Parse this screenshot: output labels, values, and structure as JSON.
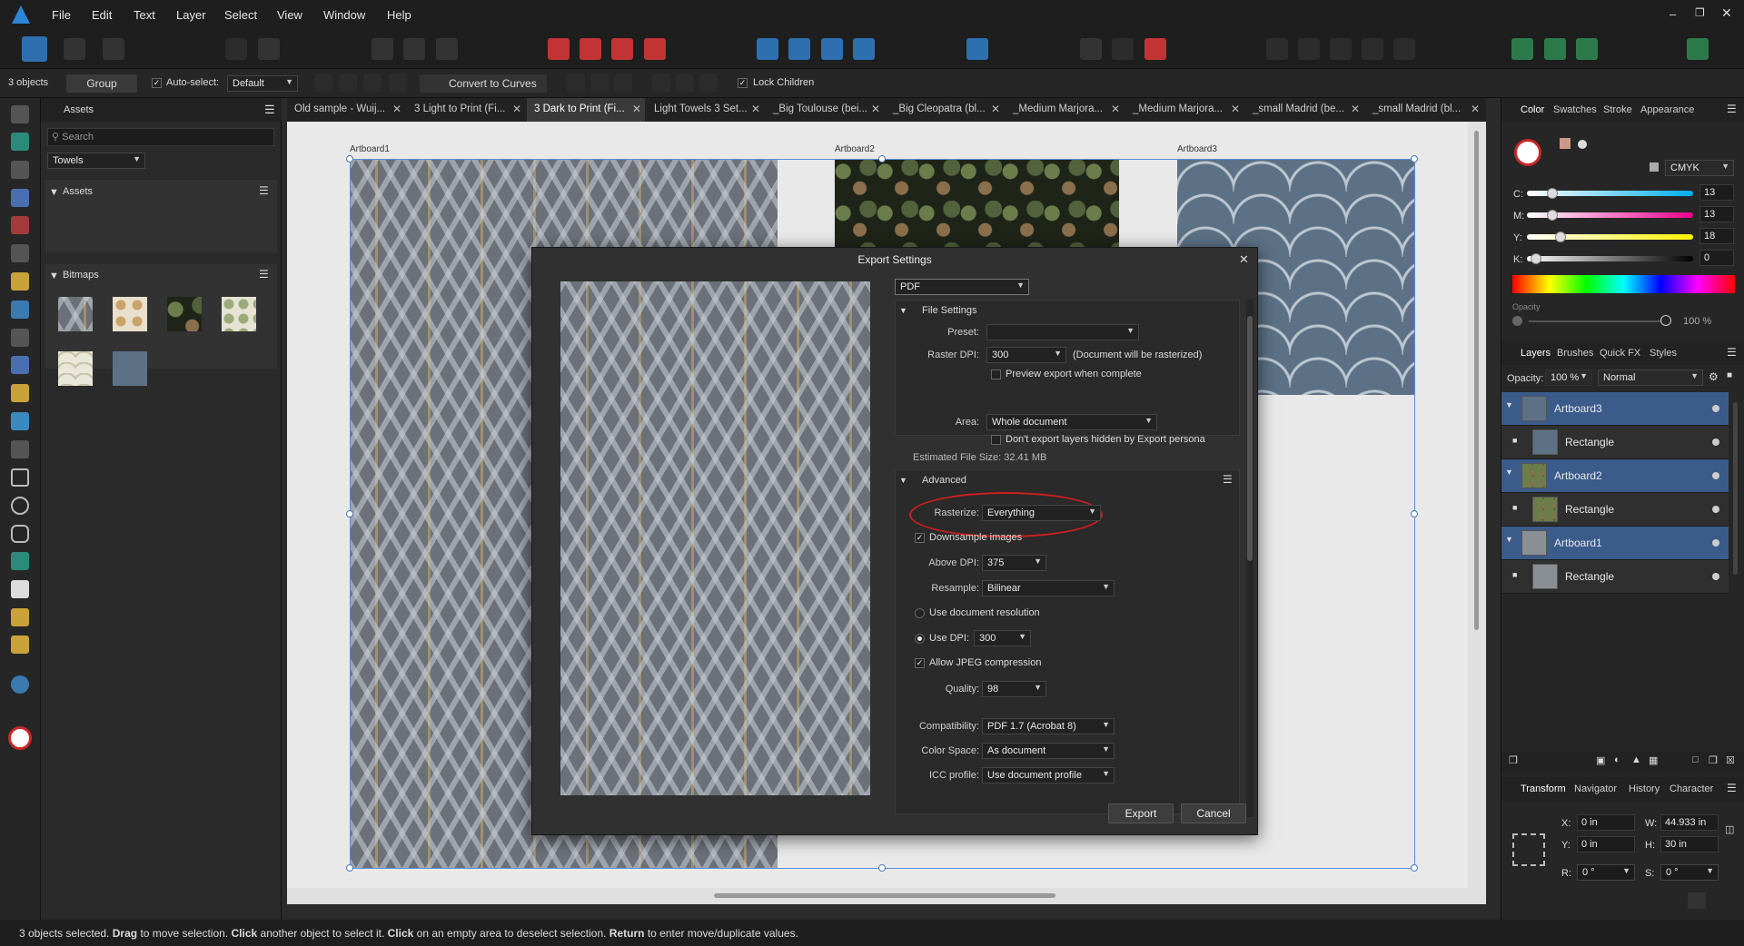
{
  "menu": [
    "File",
    "Edit",
    "Text",
    "Layer",
    "Select",
    "View",
    "Window",
    "Help"
  ],
  "context": {
    "selection_count": "3 objects",
    "group_label": "Group",
    "auto_select_label": "Auto-select:",
    "auto_select_value": "Default",
    "convert_label": "Convert to Curves",
    "lock_children_label": "Lock Children"
  },
  "tabs": [
    "Old sample - Wuij...",
    "3 Light to Print (Fi...",
    "3 Dark to Print (Fi...",
    "Light Towels 3 Set...",
    "_Big Toulouse (bei...",
    "_Big Cleopatra (bl...",
    "_Medium Marjora...",
    "_Medium Marjora...",
    "_small Madrid (be...",
    "_small Madrid (bl..."
  ],
  "assets_panel": {
    "tab": "Assets",
    "search_placeholder": "Search",
    "category": "Towels",
    "section_assets": "Assets",
    "section_bitmaps": "Bitmaps"
  },
  "artboards": [
    "Artboard1",
    "Artboard2",
    "Artboard3"
  ],
  "dialog": {
    "title": "Export Settings",
    "format": "PDF",
    "file_settings_title": "File Settings",
    "preset_label": "Preset:",
    "preset_value": "",
    "raster_dpi_label": "Raster DPI:",
    "raster_dpi_value": "300",
    "raster_note": "(Document will be rasterized)",
    "preview_label": "Preview export when complete",
    "area_label": "Area:",
    "area_value": "Whole document",
    "hidden_layers_label": "Don't export layers hidden by Export persona",
    "estimated_size": "Estimated File Size: 32.41 MB",
    "advanced_title": "Advanced",
    "rasterize_label": "Rasterize:",
    "rasterize_value": "Everything",
    "downsample_label": "Downsample images",
    "above_dpi_label": "Above DPI:",
    "above_dpi_value": "375",
    "resample_label": "Resample:",
    "resample_value": "Bilinear",
    "use_doc_res_label": "Use document resolution",
    "use_dpi_label": "Use DPI:",
    "use_dpi_value": "300",
    "jpeg_label": "Allow JPEG compression",
    "quality_label": "Quality:",
    "quality_value": "98",
    "compat_label": "Compatibility:",
    "compat_value": "PDF 1.7 (Acrobat 8)",
    "colorspace_label": "Color Space:",
    "colorspace_value": "As document",
    "icc_label": "ICC profile:",
    "icc_value": "Use document profile",
    "export_button": "Export",
    "cancel_button": "Cancel",
    "highlight_color": "#cc1f1f"
  },
  "color_panel": {
    "tabs": [
      "Color",
      "Swatches",
      "Stroke",
      "Appearance"
    ],
    "mode": "CMYK",
    "channels": [
      {
        "label": "C:",
        "value": "13",
        "level": 0.13
      },
      {
        "label": "M:",
        "value": "13",
        "level": 0.13
      },
      {
        "label": "Y:",
        "value": "18",
        "level": 0.18
      },
      {
        "label": "K:",
        "value": "0",
        "level": 0.0
      }
    ],
    "opacity_label": "Opacity",
    "opacity_value": "100 %"
  },
  "layers_panel": {
    "tabs": [
      "Layers",
      "Brushes",
      "Quick FX",
      "Styles"
    ],
    "opacity_label": "Opacity:",
    "opacity_value": "100 %",
    "blend_mode": "Normal",
    "layers": [
      {
        "name": "Artboard3",
        "selected": true,
        "thumb": "blue"
      },
      {
        "name": "Rectangle",
        "selected": false,
        "thumb": "blue"
      },
      {
        "name": "Artboard2",
        "selected": true,
        "thumb": "dark"
      },
      {
        "name": "Rectangle",
        "selected": false,
        "thumb": "dark"
      },
      {
        "name": "Artboard1",
        "selected": true,
        "thumb": "gray"
      },
      {
        "name": "Rectangle",
        "selected": false,
        "thumb": "gray"
      }
    ]
  },
  "transform_panel": {
    "tabs": [
      "Transform",
      "Navigator",
      "History",
      "Character"
    ],
    "x_label": "X:",
    "x_value": "0 in",
    "y_label": "Y:",
    "y_value": "0 in",
    "w_label": "W:",
    "w_value": "44.933 in",
    "h_label": "H:",
    "h_value": "30 in",
    "r_label": "R:",
    "r_value": "0 °",
    "s_label": "S:",
    "s_value": "0 °"
  },
  "status": {
    "p1": "3 objects selected.",
    "b1": "Drag",
    "p2": "to move selection.",
    "b2": "Click",
    "p3": "another object to select it.",
    "b3": "Click",
    "p4": "on an empty area to deselect selection.",
    "b4": "Return",
    "p5": "to enter move/duplicate values."
  }
}
